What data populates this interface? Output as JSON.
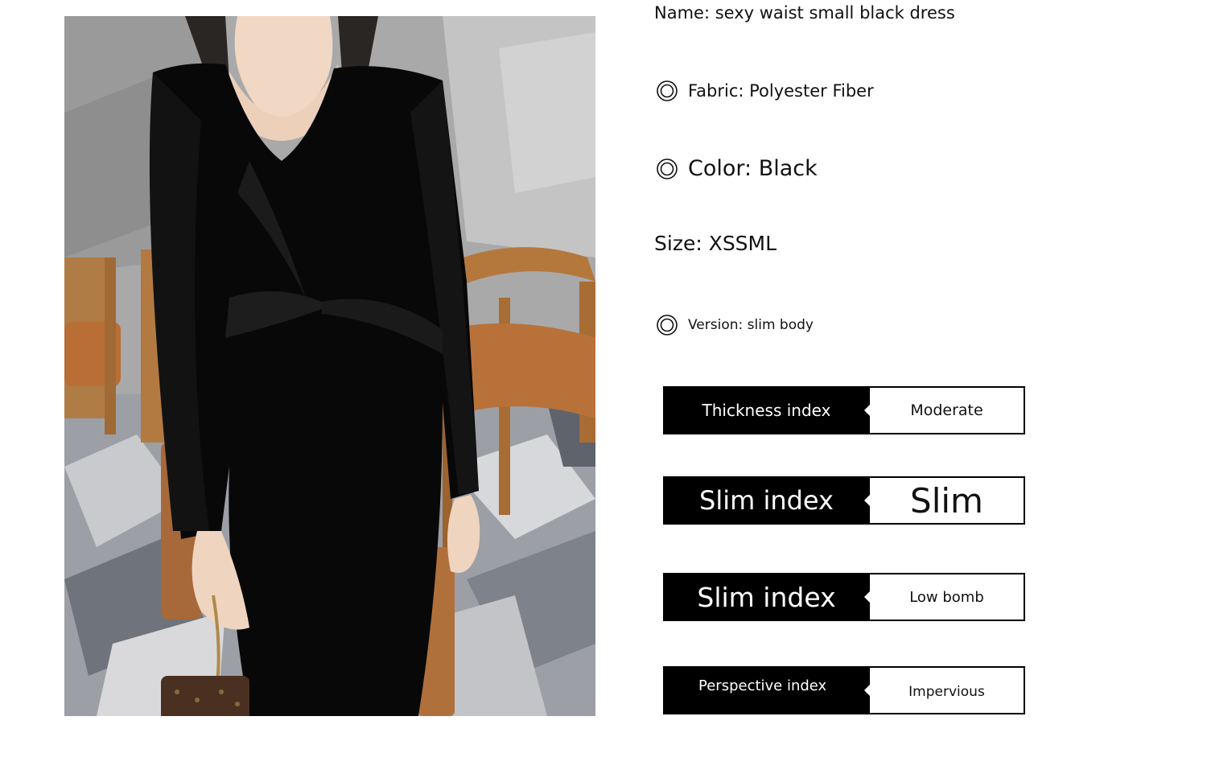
{
  "product_photo": {
    "alt": "model wearing long-sleeve black velvet dress with twisted waist"
  },
  "specs": {
    "name": "Name: sexy waist small black dress",
    "fabric": "Fabric: Polyester Fiber",
    "color": "Color: Black",
    "size": "Size: XSSML",
    "version": "Version: slim body"
  },
  "indices": [
    {
      "label": "Thickness index",
      "value": "Moderate"
    },
    {
      "label": "Slim index",
      "value": "Slim"
    },
    {
      "label": "Slim index",
      "value": "Low bomb"
    },
    {
      "label": "Perspective index",
      "value": "Impervious"
    }
  ],
  "colors": {
    "badge_black": "#000000",
    "text": "#111111",
    "background": "#ffffff"
  },
  "icons": {
    "bullet": "double-circle-icon"
  }
}
